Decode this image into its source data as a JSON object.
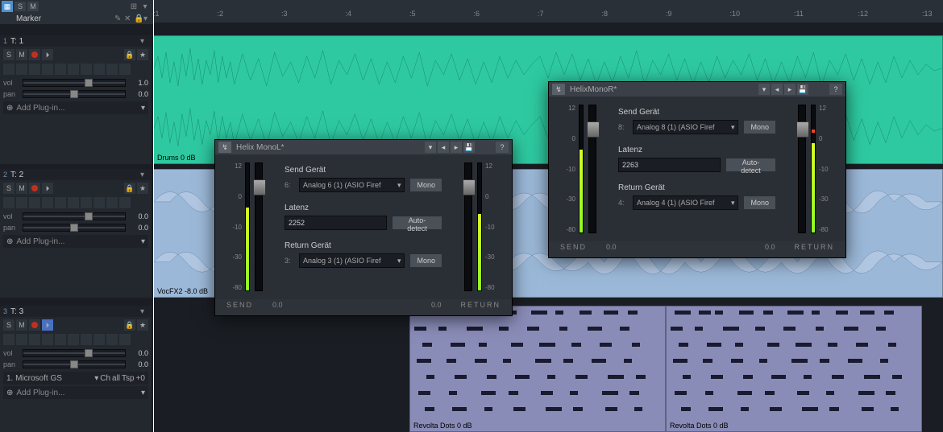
{
  "topbar": {
    "s": "S",
    "m": "M"
  },
  "marker": {
    "label": "Marker"
  },
  "ruler": {
    "ticks": [
      "1",
      "2",
      "3",
      "4",
      "5",
      "6",
      "7",
      "8",
      "9",
      "10",
      "11",
      "12",
      "13"
    ]
  },
  "tracks": [
    {
      "num": "1",
      "name": "T: 1",
      "vol_label": "vol",
      "vol_val": "1.0",
      "pan_label": "pan",
      "pan_val": "0.0",
      "plugin": "Add Plug-in...",
      "clip_label": "Drums  0 dB"
    },
    {
      "num": "2",
      "name": "T: 2",
      "vol_label": "vol",
      "vol_val": "0.0",
      "pan_label": "pan",
      "pan_val": "0.0",
      "plugin": "Add Plug-in...",
      "clip_label": "VocFX2   -8.0 dB"
    },
    {
      "num": "3",
      "name": "T: 3",
      "vol_label": "vol",
      "vol_val": "0.0",
      "pan_label": "pan",
      "pan_val": "0.0",
      "fx_row": {
        "a": "1. Microsoft GS",
        "b": "Ch",
        "c": "all",
        "d": "Tsp",
        "e": "+0"
      },
      "plugin": "Add Plug-in...",
      "clip_label_a": "Revolta Dots   0 dB",
      "clip_label_b": "Revolta Dots   0 dB"
    }
  ],
  "dialogs": [
    {
      "title": "Helix MonoL*",
      "help": "?",
      "scale_labels": [
        "12",
        "0",
        "-10",
        "-30",
        "-80"
      ],
      "send_label": "SEND",
      "send_val": "0.0",
      "return_label": "RETURN",
      "return_val": "0.0",
      "send_device_label": "Send Gerät",
      "send_device_num": "6:",
      "send_device_val": "Analog 6 (1)  (ASIO Firef",
      "mono": "Mono",
      "latency_label": "Latenz",
      "latency_val": "2252",
      "autodetect": "Auto-detect",
      "return_device_label": "Return Gerät",
      "return_device_num": "3:",
      "return_device_val": "Analog 3 (1)  (ASIO Firef"
    },
    {
      "title": "HelixMonoR*",
      "help": "?",
      "scale_labels": [
        "12",
        "0",
        "-10",
        "-30",
        "-80"
      ],
      "send_label": "SEND",
      "send_val": "0.0",
      "return_label": "RETURN",
      "return_val": "0.0",
      "send_device_label": "Send Gerät",
      "send_device_num": "8:",
      "send_device_val": "Analog 8 (1)  (ASIO Firef",
      "mono": "Mono",
      "latency_label": "Latenz",
      "latency_val": "2263",
      "autodetect": "Auto-detect",
      "return_device_label": "Return Gerät",
      "return_device_num": "4:",
      "return_device_val": "Analog 4 (1)  (ASIO Firef"
    }
  ]
}
